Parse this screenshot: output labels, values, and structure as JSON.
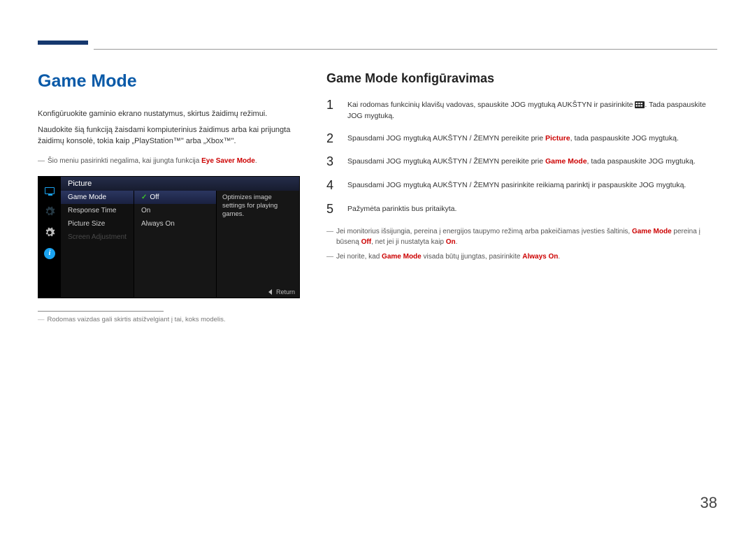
{
  "left": {
    "title": "Game Mode",
    "p1": "Konfigūruokite gaminio ekrano nustatymus, skirtus žaidimų režimui.",
    "p2": "Naudokite šią funkciją žaisdami kompiuterinius žaidimus arba kai prijungta žaidimų konsolė, tokia kaip „PlayStation™\" arba „Xbox™\".",
    "note_prefix": "―",
    "note_a": "Šio meniu pasirinkti negalima, kai įjungta funkcija ",
    "note_hl": "Eye Saver Mode",
    "note_b": ".",
    "footnote_prefix": "―",
    "footnote": "Rodomas vaizdas gali skirtis atsižvelgiant į tai, koks modelis."
  },
  "osd": {
    "header": "Picture",
    "menu": {
      "game_mode": "Game Mode",
      "response_time": "Response Time",
      "picture_size": "Picture Size",
      "screen_adjustment": "Screen Adjustment"
    },
    "options": {
      "off": "Off",
      "on": "On",
      "always_on": "Always On"
    },
    "desc": "Optimizes image settings for playing games.",
    "return": "Return"
  },
  "right": {
    "subtitle": "Game Mode konfigūravimas",
    "steps": {
      "s1_a": "Kai rodomas funkcinių klavišų vadovas, spauskite JOG mygtuką AUKŠTYN ir pasirinkite ",
      "s1_b": ". Tada paspauskite JOG mygtuką.",
      "s2_a": "Spausdami JOG mygtuką AUKŠTYN / ŽEMYN pereikite prie ",
      "s2_hl": "Picture",
      "s2_b": ", tada paspauskite JOG mygtuką.",
      "s3_a": "Spausdami JOG mygtuką AUKŠTYN / ŽEMYN pereikite prie ",
      "s3_hl": "Game Mode",
      "s3_b": ", tada paspauskite JOG mygtuką.",
      "s4": "Spausdami JOG mygtuką AUKŠTYN / ŽEMYN pasirinkite reikiamą parinktį ir paspauskite JOG mygtuką.",
      "s5": "Pažymėta parinktis bus pritaikyta."
    },
    "rnote1_a": "Jei monitorius išsijungia, pereina į energijos taupymo režimą arba pakeičiamas įvesties šaltinis, ",
    "rnote1_hl1": "Game Mode",
    "rnote1_b": " pereina į būseną ",
    "rnote1_hl2": "Off",
    "rnote1_c": ", net jei ji nustatyta kaip ",
    "rnote1_hl3": "On",
    "rnote1_d": ".",
    "rnote2_a": "Jei norite, kad ",
    "rnote2_hl1": "Game Mode",
    "rnote2_b": " visada būtų įjungtas, pasirinkite ",
    "rnote2_hl2": "Always On",
    "rnote2_c": "."
  },
  "page_number": "38"
}
